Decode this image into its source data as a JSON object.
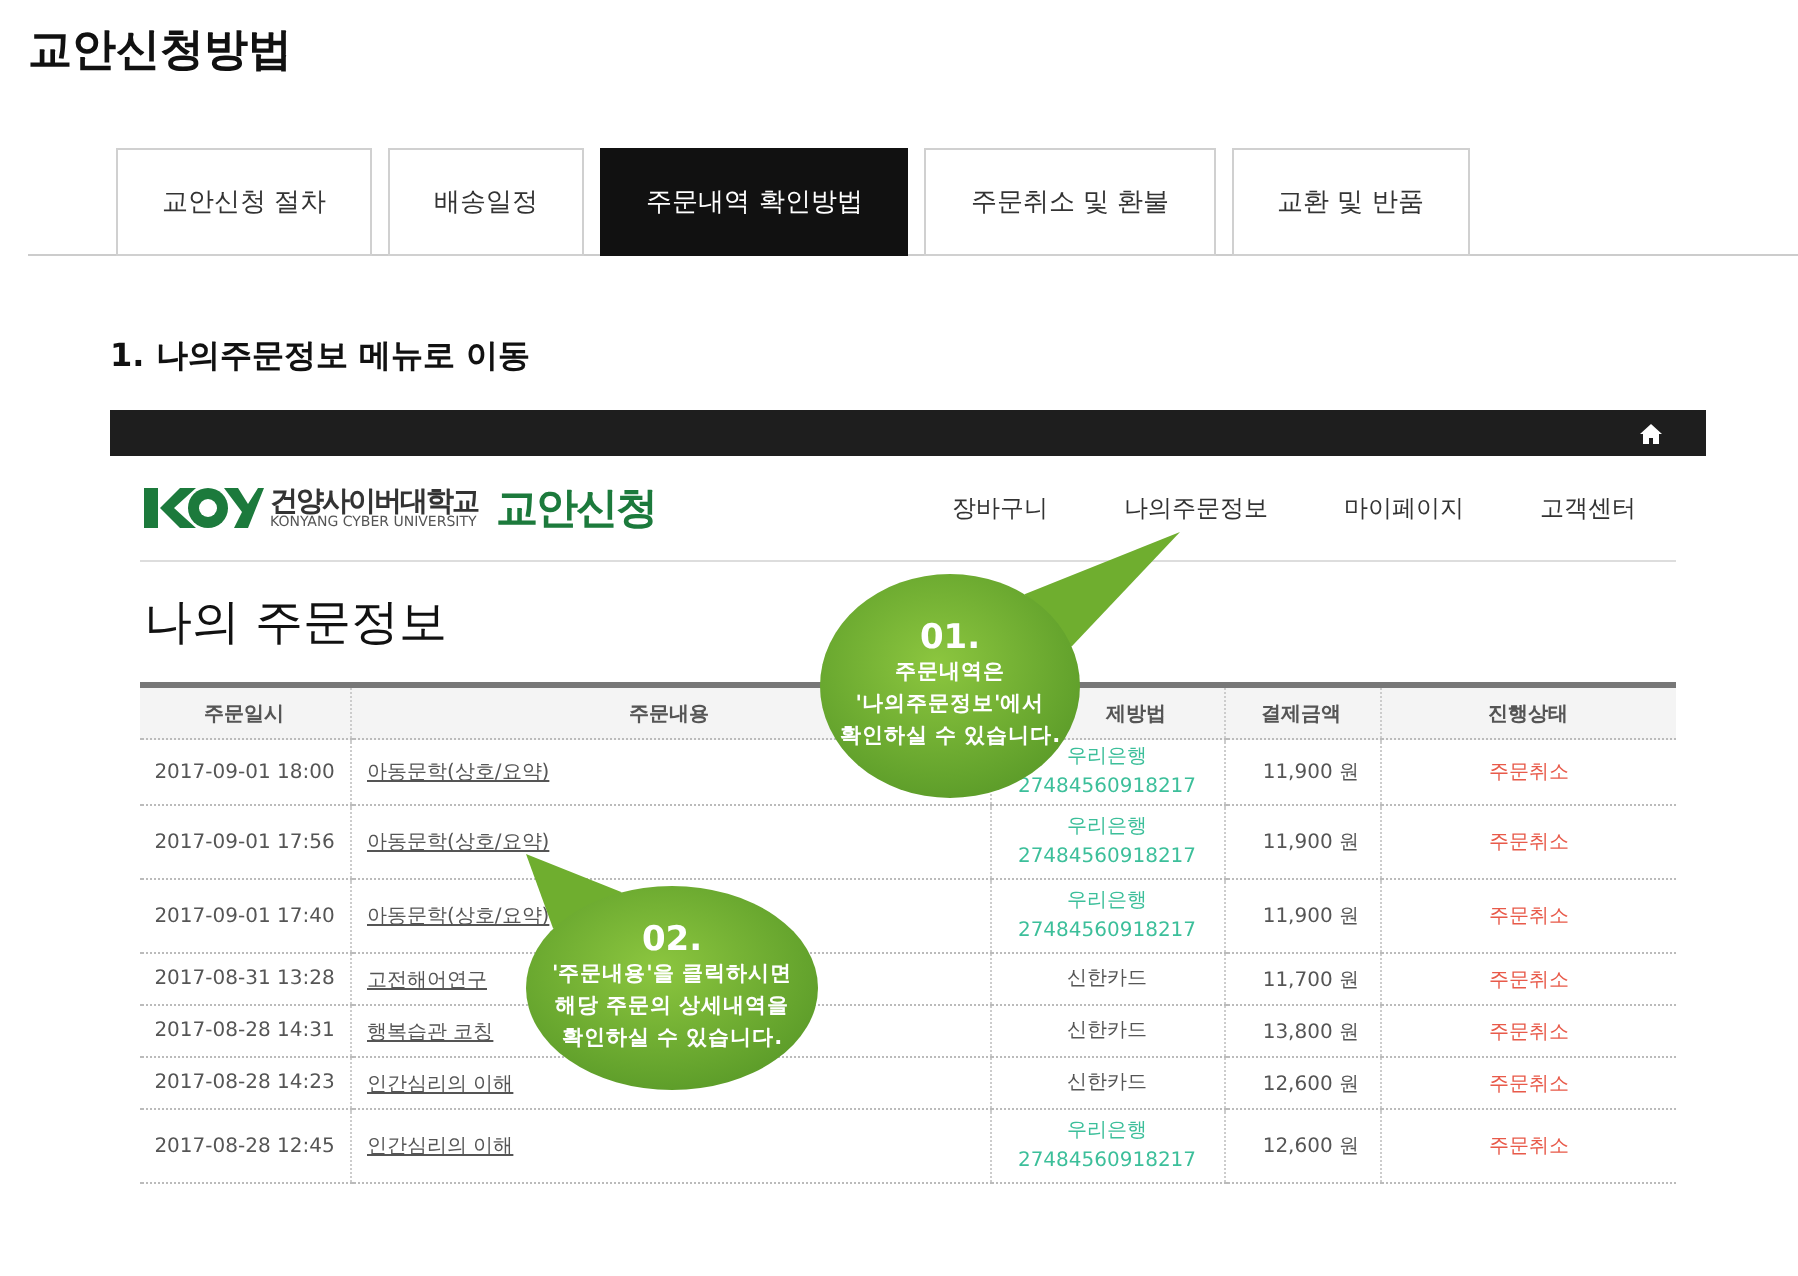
{
  "page_title": "교안신청방법",
  "tabs": [
    {
      "label": "교안신청 절차",
      "selected": false
    },
    {
      "label": "배송일정",
      "selected": false
    },
    {
      "label": "주문내역 확인방법",
      "selected": true
    },
    {
      "label": "주문취소 및 환불",
      "selected": false
    },
    {
      "label": "교환 및 반품",
      "selected": false
    }
  ],
  "step_heading": "1. 나의주문정보 메뉴로 이동",
  "site": {
    "logo": {
      "name": "건양사이버대학교",
      "name_en": "KONYANG CYBER UNIVERSITY",
      "service": "교안신청"
    },
    "nav_items": [
      "장바구니",
      "나의주문정보",
      "마이페이지",
      "고객센터"
    ],
    "page_heading": "나의 주문정보",
    "table": {
      "columns": [
        "주문일시",
        "주문내용",
        "제방법",
        "결제금액",
        "진행상태"
      ],
      "rows": [
        {
          "datetime": "2017-09-01 18:00",
          "content": "아동문학(상호/요약)",
          "kind": "bank",
          "payment": [
            "우리은행",
            "27484560918217"
          ],
          "amount": "11,900 원",
          "status": "주문취소"
        },
        {
          "datetime": "2017-09-01 17:56",
          "content": "아동문학(상호/요약)",
          "kind": "bank",
          "payment": [
            "우리은행",
            "27484560918217"
          ],
          "amount": "11,900 원",
          "status": "주문취소"
        },
        {
          "datetime": "2017-09-01 17:40",
          "content": "아동문학(상호/요약)",
          "kind": "bank",
          "payment": [
            "우리은행",
            "27484560918217"
          ],
          "amount": "11,900 원",
          "status": "주문취소"
        },
        {
          "datetime": "2017-08-31 13:28",
          "content": "고전해어연구",
          "kind": "card",
          "payment": [
            "신한카드"
          ],
          "amount": "11,700 원",
          "status": "주문취소"
        },
        {
          "datetime": "2017-08-28 14:31",
          "content": "행복습관 코칭",
          "kind": "card",
          "payment": [
            "신한카드"
          ],
          "amount": "13,800 원",
          "status": "주문취소"
        },
        {
          "datetime": "2017-08-28 14:23",
          "content": "인간심리의 이해",
          "kind": "card",
          "payment": [
            "신한카드"
          ],
          "amount": "12,600 원",
          "status": "주문취소"
        },
        {
          "datetime": "2017-08-28 12:45",
          "content": "인간심리의 이해",
          "kind": "bank",
          "payment": [
            "우리은행",
            "27484560918217"
          ],
          "amount": "12,600 원",
          "status": "주문취소"
        }
      ]
    },
    "callouts": [
      {
        "number": "01.",
        "lines": [
          "주문내역은",
          "'나의주문정보'에서",
          "확인하실 수 있습니다."
        ]
      },
      {
        "number": "02.",
        "lines": [
          "'주문내용'을 클릭하시면",
          "해당 주문의 상세내역을",
          "확인하실 수 있습니다."
        ]
      }
    ]
  }
}
